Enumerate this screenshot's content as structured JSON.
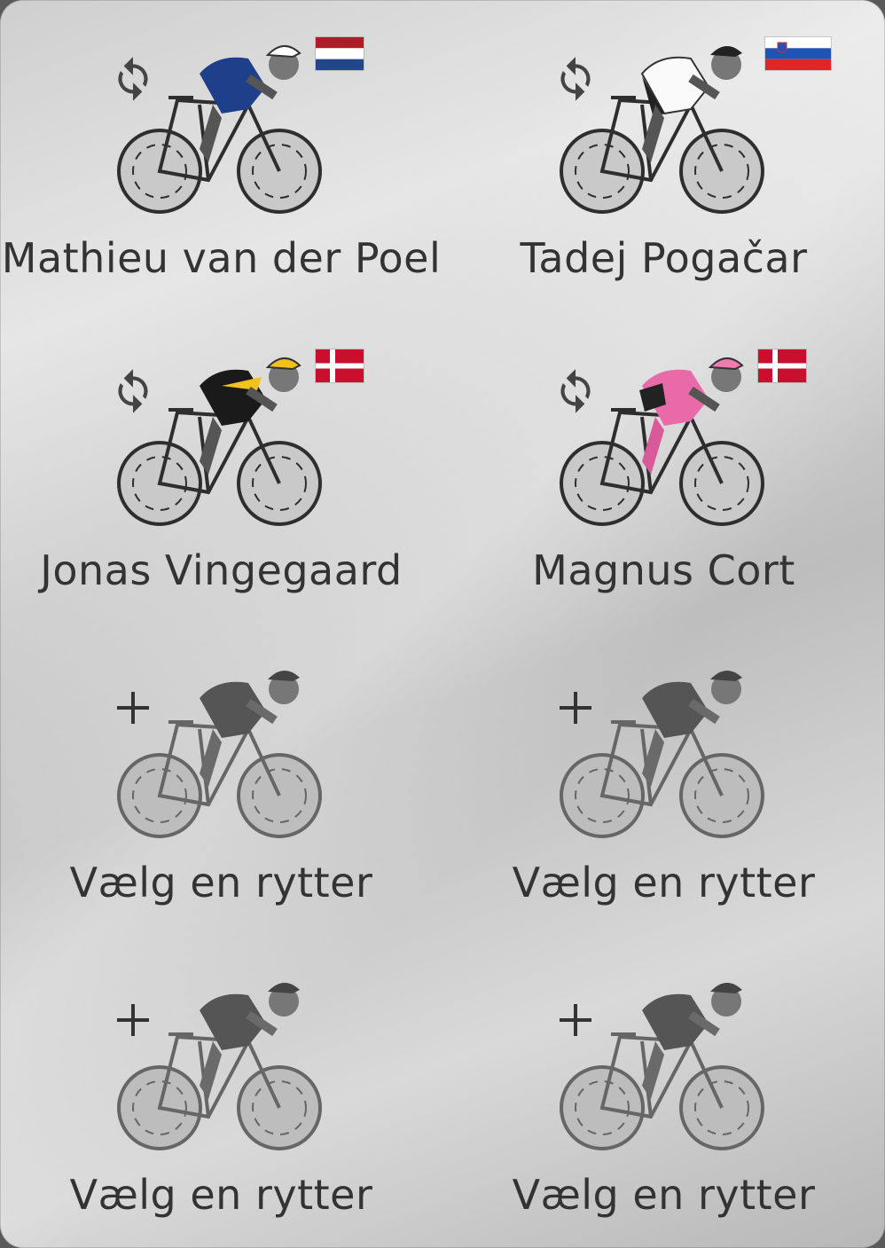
{
  "riders": [
    {
      "name": "Mathieu van der Poel",
      "flag": "netherlands-flag",
      "jersey": "#1e3f8a",
      "helmet": "#ffffff",
      "filled": true
    },
    {
      "name": "Tadej Pogačar",
      "flag": "slovenia-flag",
      "jersey": "#ffffff",
      "helmet": "#222222",
      "filled": true
    },
    {
      "name": "Jonas Vingegaard",
      "flag": "denmark-flag",
      "jersey": "#1a1a1a",
      "helmet": "#f2c21b",
      "filled": true
    },
    {
      "name": "Magnus Cort",
      "flag": "denmark-flag",
      "jersey": "#e86aa8",
      "helmet": "#f07bb0",
      "filled": true
    },
    {
      "name": "Vælg en rytter",
      "filled": false
    },
    {
      "name": "Vælg en rytter",
      "filled": false
    },
    {
      "name": "Vælg en rytter",
      "filled": false
    },
    {
      "name": "Vælg en rytter",
      "filled": false
    }
  ],
  "icons": {
    "swap": "swap-icon",
    "add": "plus-icon"
  }
}
